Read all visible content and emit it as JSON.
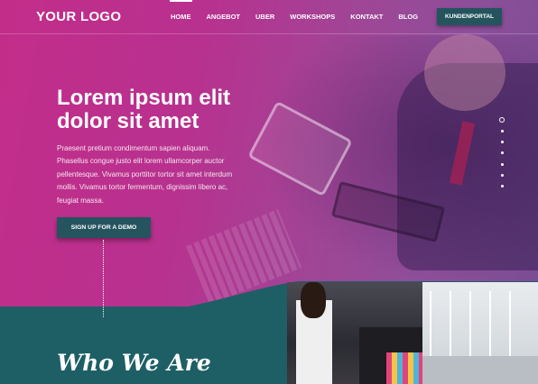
{
  "header": {
    "logo": "YOUR LOGO",
    "nav": [
      "HOME",
      "ANGEBOT",
      "UBER",
      "WORKSHOPS",
      "KONTAKT",
      "BLOG"
    ],
    "active_nav": "HOME",
    "portal_button": "KUNDENPORTAL"
  },
  "hero": {
    "headline_line1": "Lorem ipsum elit",
    "headline_line2": "dolor sit amet",
    "body": "Praesent pretium condimentum sapien aliquam. Phasellus congue justo elit lorem ullamcorper auctor pellentesque. Vivamus porttitor tortor sit amet interdum mollis. Vivamus tortor fermentum, dignissim libero ac, feugiat massa.",
    "cta_label": "SIGN UP FOR A DEMO",
    "slide_count": 7,
    "active_slide": 1
  },
  "about": {
    "title": "Who We Are"
  },
  "colors": {
    "hero_pink": "#c32d8a",
    "hero_purple": "#7b4c94",
    "teal": "#1e5f66",
    "button": "#25545f"
  }
}
